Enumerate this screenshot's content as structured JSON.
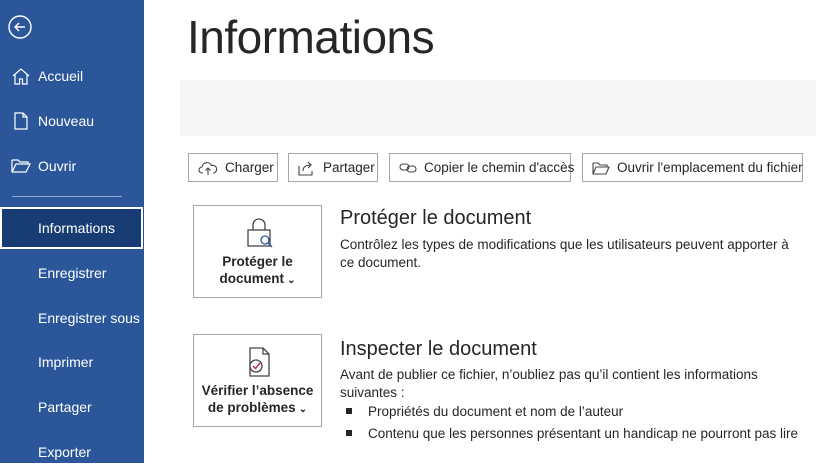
{
  "sidebar": {
    "items": [
      {
        "label": "Accueil",
        "icon": "home-icon"
      },
      {
        "label": "Nouveau",
        "icon": "new-document-icon"
      },
      {
        "label": "Ouvrir",
        "icon": "folder-open-icon"
      },
      {
        "label": "Informations",
        "active": true
      },
      {
        "label": "Enregistrer"
      },
      {
        "label": "Enregistrer sous"
      },
      {
        "label": "Imprimer"
      },
      {
        "label": "Partager"
      },
      {
        "label": "Exporter"
      }
    ],
    "back_icon": "back-arrow-icon"
  },
  "main": {
    "title": "Informations",
    "toolbar": [
      {
        "label": "Charger",
        "icon": "cloud-upload-icon"
      },
      {
        "label": "Partager",
        "icon": "share-icon"
      },
      {
        "label": "Copier le chemin d'accès",
        "icon": "link-icon"
      },
      {
        "label": "Ouvrir l'emplacement du fichier",
        "icon": "folder-icon"
      }
    ],
    "protect": {
      "button_line1": "Protéger le",
      "button_line2": "document",
      "heading": "Protéger le document",
      "description": "Contrôlez les types de modifications que les utilisateurs peuvent apporter à ce document."
    },
    "inspect": {
      "button_line1": "Vérifier l’absence",
      "button_line2": "de problèmes",
      "heading": "Inspecter le document",
      "description": "Avant de publier ce fichier, n’oubliez pas qu’il contient les informations suivantes :",
      "bullets": [
        "Propriétés du document et nom de l’auteur",
        "Contenu que les personnes présentant un handicap ne pourront pas lire"
      ]
    }
  },
  "colors": {
    "sidebar": "#2b579a",
    "active_item": "#183d74"
  }
}
